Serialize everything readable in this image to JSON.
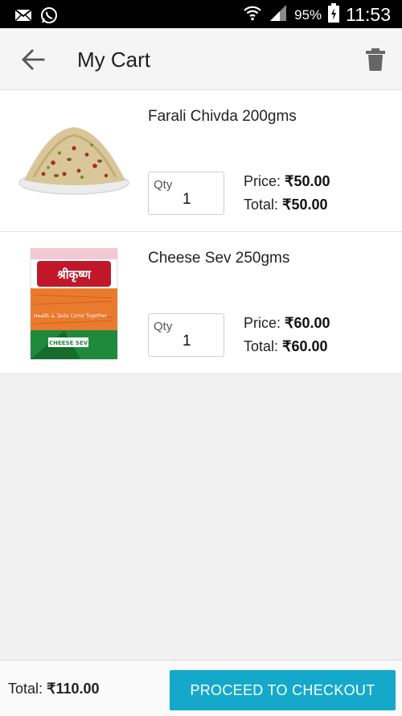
{
  "status_bar": {
    "battery": "95%",
    "time": "11:53",
    "icons": [
      "mail-icon",
      "whatsapp-icon",
      "wifi-icon",
      "signal-icon",
      "battery-charging-icon"
    ]
  },
  "app_bar": {
    "title": "My Cart",
    "back_icon": "arrow-left-icon",
    "delete_icon": "trash-icon"
  },
  "cart": {
    "items": [
      {
        "name": "Farali Chivda 200gms",
        "qty_label": "Qty",
        "qty": "1",
        "price_label": "Price:",
        "price": "₹50.00",
        "total_label": "Total:",
        "total": "₹50.00"
      },
      {
        "name": "Cheese Sev 250gms",
        "qty_label": "Qty",
        "qty": "1",
        "price_label": "Price:",
        "price": "₹60.00",
        "total_label": "Total:",
        "total": "₹60.00",
        "package_brand": "श्रीकृष्ण",
        "package_tagline": "Health & Taste Come Together",
        "package_product": "CHEESE SEV"
      }
    ]
  },
  "footer": {
    "total_label": "Total:",
    "total_value": "₹110.00",
    "checkout_label": "PROCEED TO CHECKOUT"
  },
  "colors": {
    "accent": "#14a9cb",
    "status_bar": "#000000",
    "app_bar": "#f5f5f5"
  }
}
